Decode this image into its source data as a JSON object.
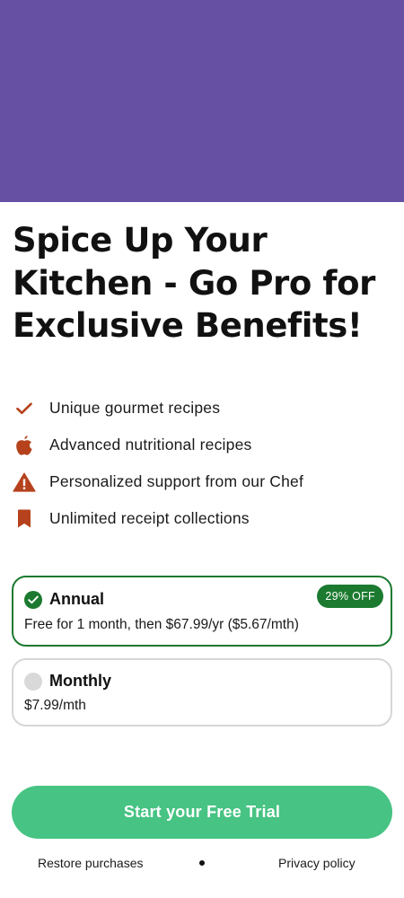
{
  "colors": {
    "hero": "#6650a4",
    "accent_icon": "#b5421c",
    "selected_green": "#1b7a2f",
    "cta_green": "#47c383"
  },
  "headline": "Spice Up Your Kitchen - Go Pro for Exclusive Benefits!",
  "features": [
    {
      "icon": "check-icon",
      "text": "Unique gourmet recipes"
    },
    {
      "icon": "apple-icon",
      "text": "Advanced nutritional recipes"
    },
    {
      "icon": "warning-icon",
      "text": "Personalized support from our Chef"
    },
    {
      "icon": "bookmark-icon",
      "text": "Unlimited receipt collections"
    }
  ],
  "plans": {
    "annual": {
      "name": "Annual",
      "description": "Free for 1 month, then $67.99/yr ($5.67/mth)",
      "badge": "29% OFF",
      "selected": true
    },
    "monthly": {
      "name": "Monthly",
      "description": "$7.99/mth",
      "selected": false
    }
  },
  "cta_label": "Start your Free Trial",
  "footer": {
    "restore": "Restore purchases",
    "privacy": "Privacy policy"
  }
}
